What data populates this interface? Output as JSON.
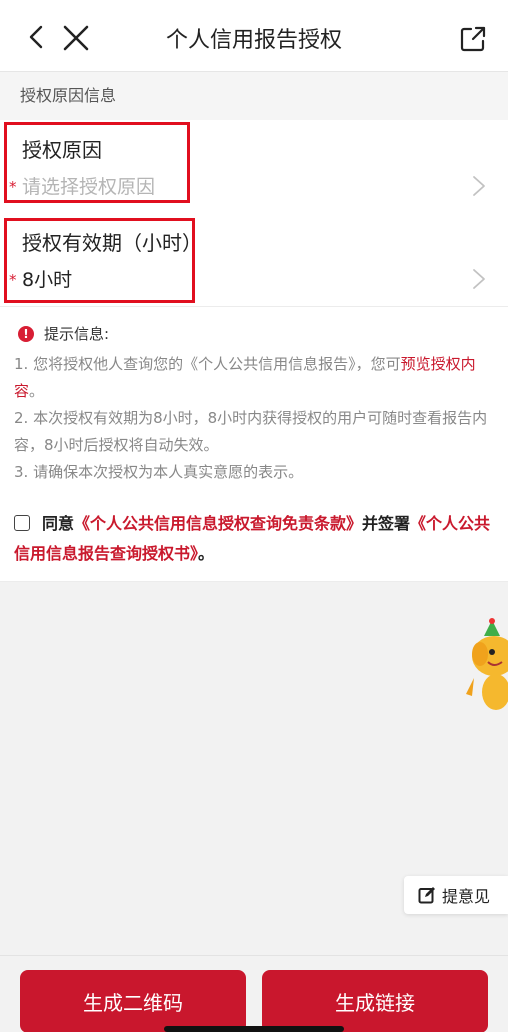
{
  "nav": {
    "title": "个人信用报告授权"
  },
  "section": {
    "label": "授权原因信息"
  },
  "fields": [
    {
      "title": "授权原因",
      "required_mark": "*",
      "placeholder": "请选择授权原因"
    },
    {
      "title": "授权有效期（小时）",
      "required_mark": "*",
      "value": "8小时"
    }
  ],
  "tips": {
    "icon": "!",
    "title": "提示信息:",
    "line1_prefix": "1. 您将授权他人查询您的《个人公共信用信息报告》，您可",
    "line1_link": "预览授权内容",
    "line1_suffix": "。",
    "line2": "2. 本次授权有效期为8小时，8小时内获得授权的用户可随时查看报告内容，8小时后授权将自动失效。",
    "line3": "3. 请确保本次授权为本人真实意愿的表示。"
  },
  "agreement": {
    "agree_text": "同意",
    "link1": "《个人公共信用信息授权查询免责条款》",
    "middle_text": "并签署",
    "link2": "《个人公共信用信息报告查询授权书》",
    "end_text": "。"
  },
  "feedback": {
    "label": "提意见"
  },
  "buttons": {
    "qr_label": "生成二维码",
    "link_label": "生成链接"
  },
  "colors": {
    "accent": "#c9172d",
    "highlight_border": "#e10f1f"
  }
}
